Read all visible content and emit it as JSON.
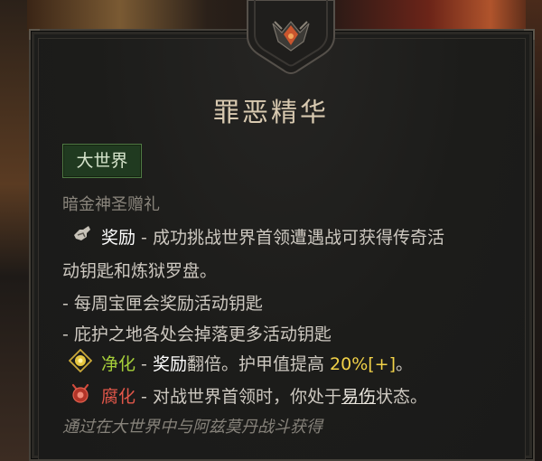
{
  "tooltip": {
    "title": "罪恶精华",
    "badge": "大世界",
    "subtitle": "暗金神圣赠礼",
    "reward": {
      "keyword": "奖励",
      "text_1": " - 成功挑战世界首领遭遇战可获得传奇活",
      "text_2": "动钥匙和炼狱罗盘。"
    },
    "bullets": [
      "- 每周宝匣会奖励活动钥匙",
      "- 庇护之地各处会掉落更多活动钥匙"
    ],
    "purify": {
      "keyword": "净化",
      "sep": " - ",
      "reward_keyword": "奖励",
      "text_a": "翻倍。护甲值提高 ",
      "percent": "20%[+]",
      "text_b": "。"
    },
    "corrupt": {
      "keyword": "腐化",
      "text_a": " - 对战世界首领时，你处于",
      "status": "易伤",
      "text_b": "状态。"
    },
    "footer": "通过在大世界中与阿兹莫丹战斗获得"
  },
  "icons": {
    "crest": "demonic-crest-icon",
    "reward": "key-reward-icon",
    "purify": "purify-orb-icon",
    "corrupt": "corrupt-demon-icon"
  },
  "colors": {
    "badge_bg": "#203a20",
    "purify": "#a6cf3a",
    "percent": "#f2d248",
    "corrupt": "#e2574a"
  }
}
